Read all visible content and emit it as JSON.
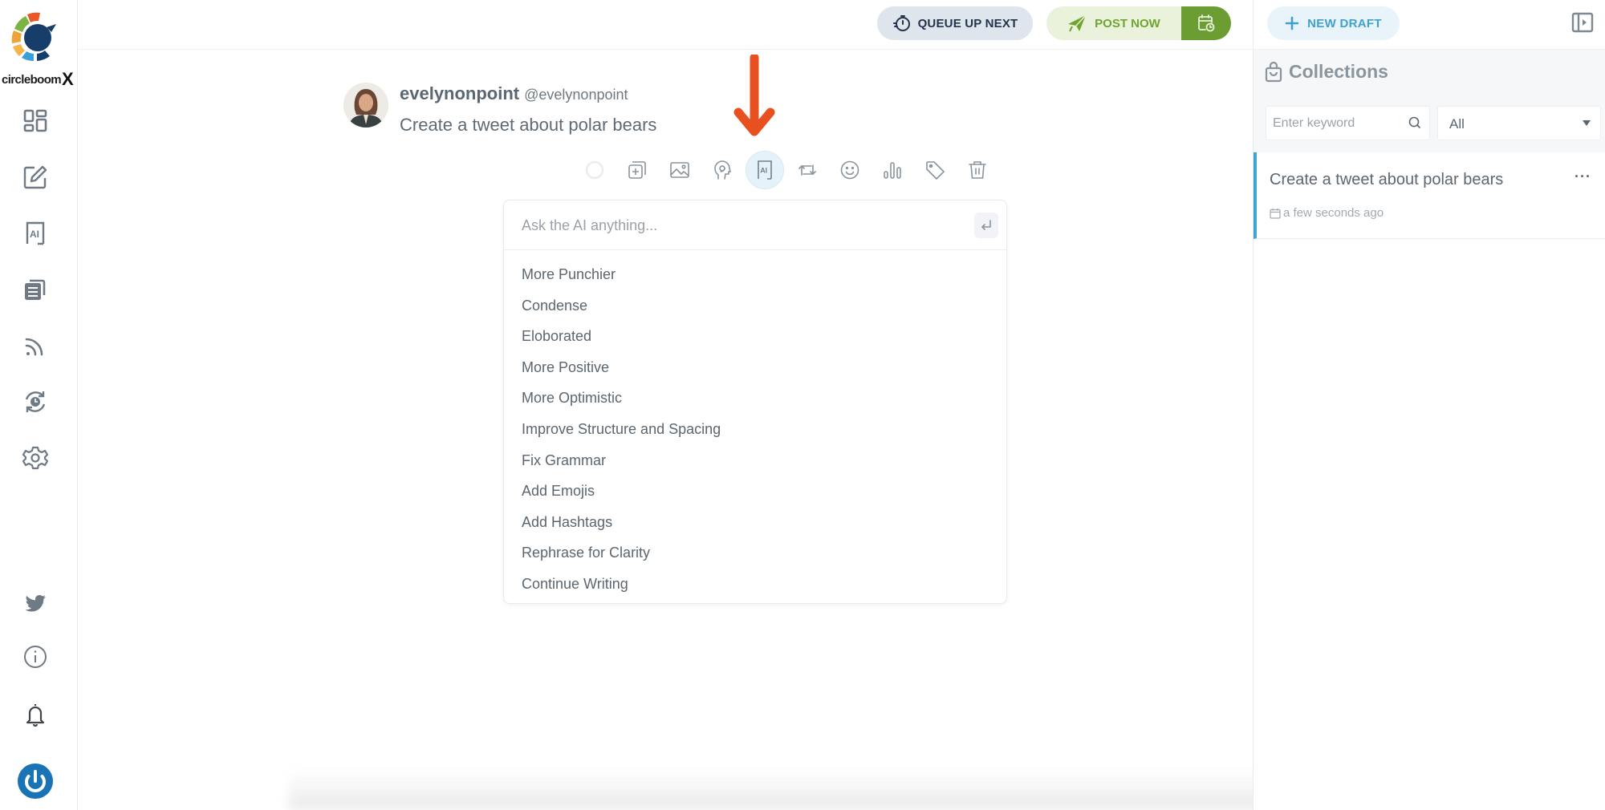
{
  "brand": {
    "name": "circleboom",
    "suffix": "X"
  },
  "sidebar": {
    "items": [
      {
        "name": "dashboard",
        "icon": "grid-icon"
      },
      {
        "name": "compose",
        "icon": "edit-icon"
      },
      {
        "name": "ai-writer",
        "icon": "ai-icon"
      },
      {
        "name": "drafts",
        "icon": "documents-icon"
      },
      {
        "name": "rss",
        "icon": "rss-icon"
      },
      {
        "name": "scheduled",
        "icon": "clock-sync-icon"
      },
      {
        "name": "settings",
        "icon": "gear-icon"
      }
    ],
    "bottom_items": [
      {
        "name": "twitter",
        "icon": "twitter-icon"
      },
      {
        "name": "info",
        "icon": "info-icon"
      },
      {
        "name": "notifications",
        "icon": "bell-icon"
      },
      {
        "name": "account",
        "icon": "power-icon"
      }
    ]
  },
  "topbar": {
    "queue_label": "QUEUE UP NEXT",
    "post_label": "POST NOW",
    "schedule_icon": "calendar-clock-icon"
  },
  "composer": {
    "display_name": "evelynonpoint",
    "handle": "@evelynonpoint",
    "text": "Create a tweet about polar bears",
    "toolbar": [
      {
        "name": "character-counter",
        "icon": "progress-ring-icon"
      },
      {
        "name": "add-thread",
        "icon": "add-copy-icon"
      },
      {
        "name": "add-image",
        "icon": "image-icon"
      },
      {
        "name": "ai-brain",
        "icon": "brain-head-icon"
      },
      {
        "name": "ai-assistant",
        "icon": "ai-icon",
        "active": true
      },
      {
        "name": "retweet",
        "icon": "retweet-icon"
      },
      {
        "name": "emoji",
        "icon": "emoji-icon"
      },
      {
        "name": "poll",
        "icon": "poll-icon"
      },
      {
        "name": "tag",
        "icon": "tag-icon"
      },
      {
        "name": "delete",
        "icon": "trash-icon"
      }
    ]
  },
  "annotation": {
    "arrow_color": "#e8501f"
  },
  "ai_panel": {
    "placeholder": "Ask the AI anything...",
    "value": "",
    "options": [
      "More Punchier",
      "Condense",
      "Eloborated",
      "More Positive",
      "More Optimistic",
      "Improve Structure and Spacing",
      "Fix Grammar",
      "Add Emojis",
      "Add Hashtags",
      "Rephrase for Clarity",
      "Continue Writing"
    ]
  },
  "right_panel": {
    "new_draft_label": "NEW DRAFT",
    "collections_title": "Collections",
    "keyword_placeholder": "Enter keyword",
    "filter_value": "All",
    "drafts": [
      {
        "title": "Create a tweet about polar bears",
        "time": "a few seconds ago"
      }
    ]
  },
  "colors": {
    "accent_blue": "#3fa6d4",
    "post_green": "#6b9d32",
    "queue_navy": "#23344a"
  }
}
